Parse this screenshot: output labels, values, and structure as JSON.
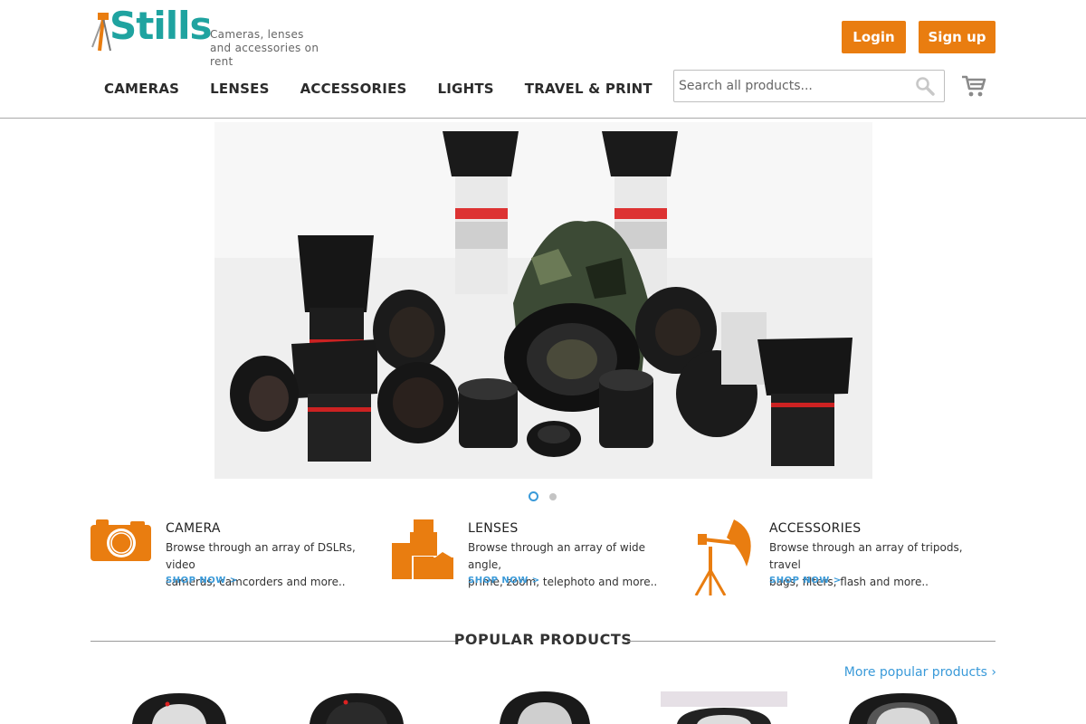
{
  "brand": {
    "logo_text": "Stills",
    "tagline": "Cameras, lenses and accessories on rent",
    "accent_color": "#e97d10",
    "logo_color": "#1fa3a0",
    "link_color": "#3a9ad9"
  },
  "header": {
    "login_label": "Login",
    "signup_label": "Sign up"
  },
  "nav": {
    "items": [
      {
        "label": "CAMERAS"
      },
      {
        "label": "LENSES"
      },
      {
        "label": "ACCESSORIES"
      },
      {
        "label": "LIGHTS"
      },
      {
        "label": "TRAVEL & PRINT"
      }
    ]
  },
  "search": {
    "placeholder": "Search all products...",
    "icon": "search-icon"
  },
  "cart": {
    "icon": "cart-icon"
  },
  "hero": {
    "slide_count": 2,
    "active_slide": 1
  },
  "categories": [
    {
      "icon": "camera-icon",
      "title": "CAMERA",
      "desc_line1": "Browse through an array of DSLRs, video",
      "desc_line2": "cameras, camcorders and more..",
      "link": "SHOP NOW >"
    },
    {
      "icon": "lenses-icon",
      "title": "LENSES",
      "desc_line1": "Browse through an array of wide angle,",
      "desc_line2": "prime, zoom, telephoto and more..",
      "link": "SHOP NOW >"
    },
    {
      "icon": "tripod-light-icon",
      "title": "ACCESSORIES",
      "desc_line1": "Browse through an array of tripods, travel",
      "desc_line2": "bags, filters, flash and more..",
      "link": "SHOP NOW >"
    }
  ],
  "popular": {
    "title": "POPULAR PRODUCTS",
    "more_link": "More popular products ›"
  }
}
